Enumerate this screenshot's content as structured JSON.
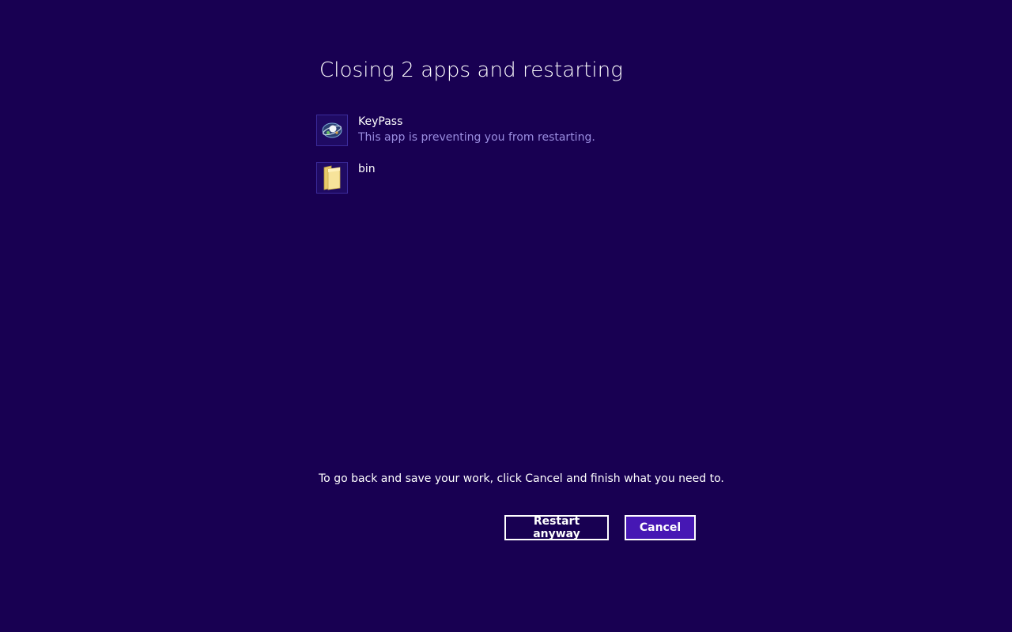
{
  "dialog": {
    "title": "Closing 2 apps and restarting",
    "apps": [
      {
        "name": "KeyPass",
        "status": "This app is preventing you from restarting.",
        "icon": "keypass-icon"
      },
      {
        "name": "bin",
        "status": "",
        "icon": "folder-icon"
      }
    ],
    "footer_text": "To go back and save your work, click Cancel and finish what you need to.",
    "buttons": {
      "restart_label": "Restart anyway",
      "cancel_label": "Cancel"
    }
  },
  "colors": {
    "background": "#180052",
    "status_text": "#9a8de0",
    "cancel_button": "#4617b4",
    "icon_border": "#3b2b9b"
  }
}
